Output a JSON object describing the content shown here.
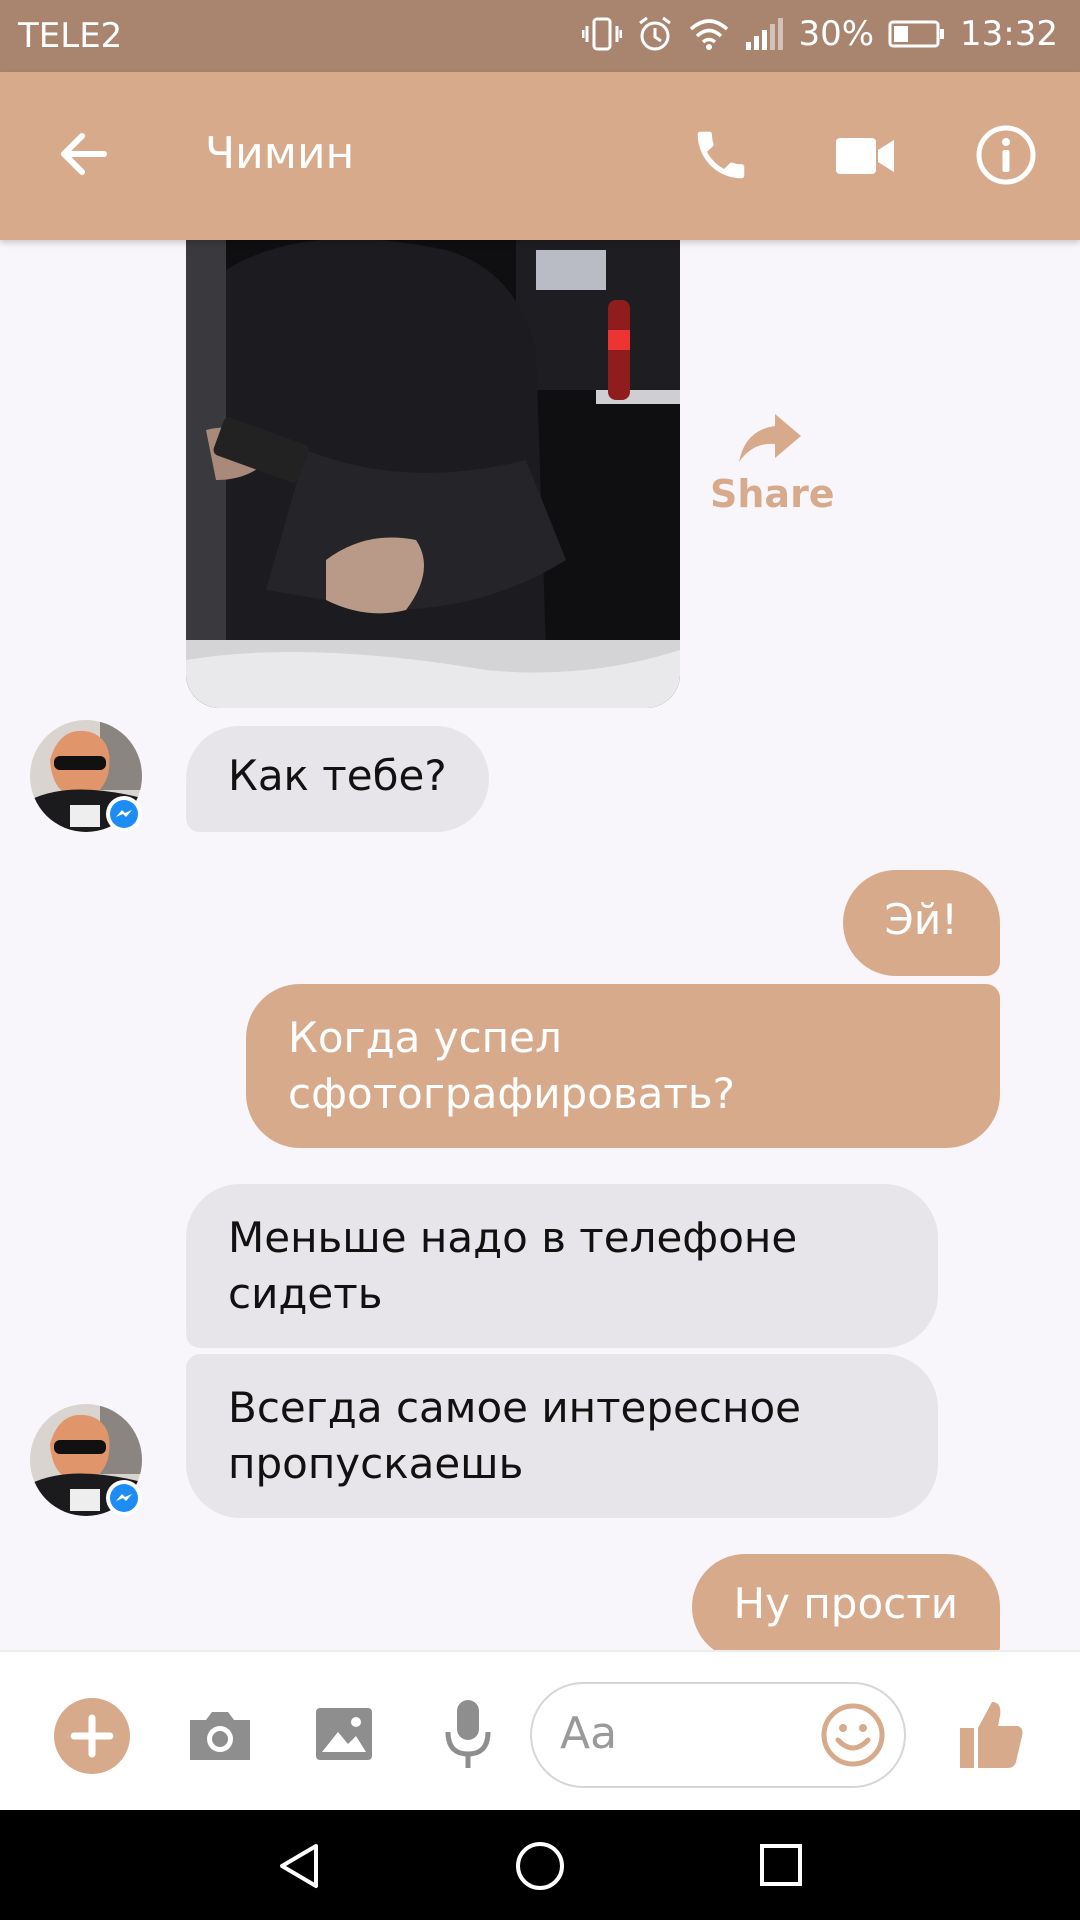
{
  "status_bar": {
    "carrier": "TELE2",
    "battery": "30%",
    "time": "13:32",
    "icons": [
      "vibrate-icon",
      "alarm-icon",
      "wifi-icon",
      "signal-icon",
      "battery-icon"
    ]
  },
  "header": {
    "contact_name": "Чимин",
    "icons": [
      "back-arrow-icon",
      "phone-icon",
      "video-camera-icon",
      "info-icon"
    ]
  },
  "conversation": {
    "share_label": "Share",
    "messages": [
      {
        "direction": "incoming",
        "text": "Как тебе?"
      },
      {
        "direction": "outgoing",
        "text": "Эй!"
      },
      {
        "direction": "outgoing",
        "text": "Когда успел сфотографировать?"
      },
      {
        "direction": "incoming",
        "text": "Меньше надо в телефоне сидеть"
      },
      {
        "direction": "incoming",
        "text": "Всегда самое интересное пропускаешь"
      },
      {
        "direction": "outgoing",
        "text": "Ну прости"
      }
    ]
  },
  "composer": {
    "placeholder": "Aa",
    "icons": [
      "plus-icon",
      "camera-icon",
      "image-icon",
      "microphone-icon",
      "emoji-icon",
      "thumbs-up-icon"
    ]
  },
  "nav_bar": {
    "icons": [
      "back-triangle-icon",
      "home-circle-icon",
      "recents-square-icon"
    ]
  },
  "colors": {
    "accent": "#d8aa8c",
    "status_bar": "#a98570",
    "incoming_bubble": "#e7e5ea",
    "background": "#f8f6fa"
  }
}
